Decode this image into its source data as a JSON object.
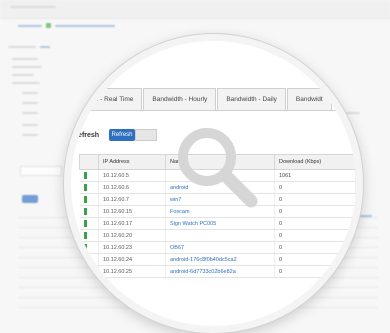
{
  "tabs": [
    "Bandwidth - Real Time",
    "Bandwidth - Hourly",
    "Bandwidth - Daily",
    "Bandwidt"
  ],
  "refresh": {
    "label": "Refresh",
    "button": "Refresh"
  },
  "side_label": "...",
  "table": {
    "columns": [
      "IP Address",
      "Name",
      "Download (Kbps)"
    ],
    "rows": [
      {
        "ip": "10.12.60.5",
        "name": "",
        "dl": "1061"
      },
      {
        "ip": "10.12.60.6",
        "name": "android",
        "dl": "0"
      },
      {
        "ip": "10.12.60.7",
        "name": "win7",
        "dl": "0"
      },
      {
        "ip": "10.12.60.15",
        "name": "Foscam",
        "dl": "0"
      },
      {
        "ip": "10.12.60.17",
        "name": "Sign Watch PC005",
        "dl": "0"
      },
      {
        "ip": "10.12.60.20",
        "name": "",
        "dl": "0"
      },
      {
        "ip": "10.12.60.23",
        "name": "OB67",
        "dl": "0"
      },
      {
        "ip": "10.12.60.24",
        "name": "android-176c8f0b40dc5ca2",
        "dl": "0"
      },
      {
        "ip": "10.12.60.25",
        "name": "android-6d7733c02b6e82a",
        "dl": "0"
      }
    ]
  },
  "icons": {
    "magnifier": "magnifying-glass-icon",
    "flag": "online-status-icon"
  },
  "colors": {
    "accent": "#2f6fbf",
    "status_ok": "#3aa04a",
    "magnifier": "#d6d6d6"
  }
}
